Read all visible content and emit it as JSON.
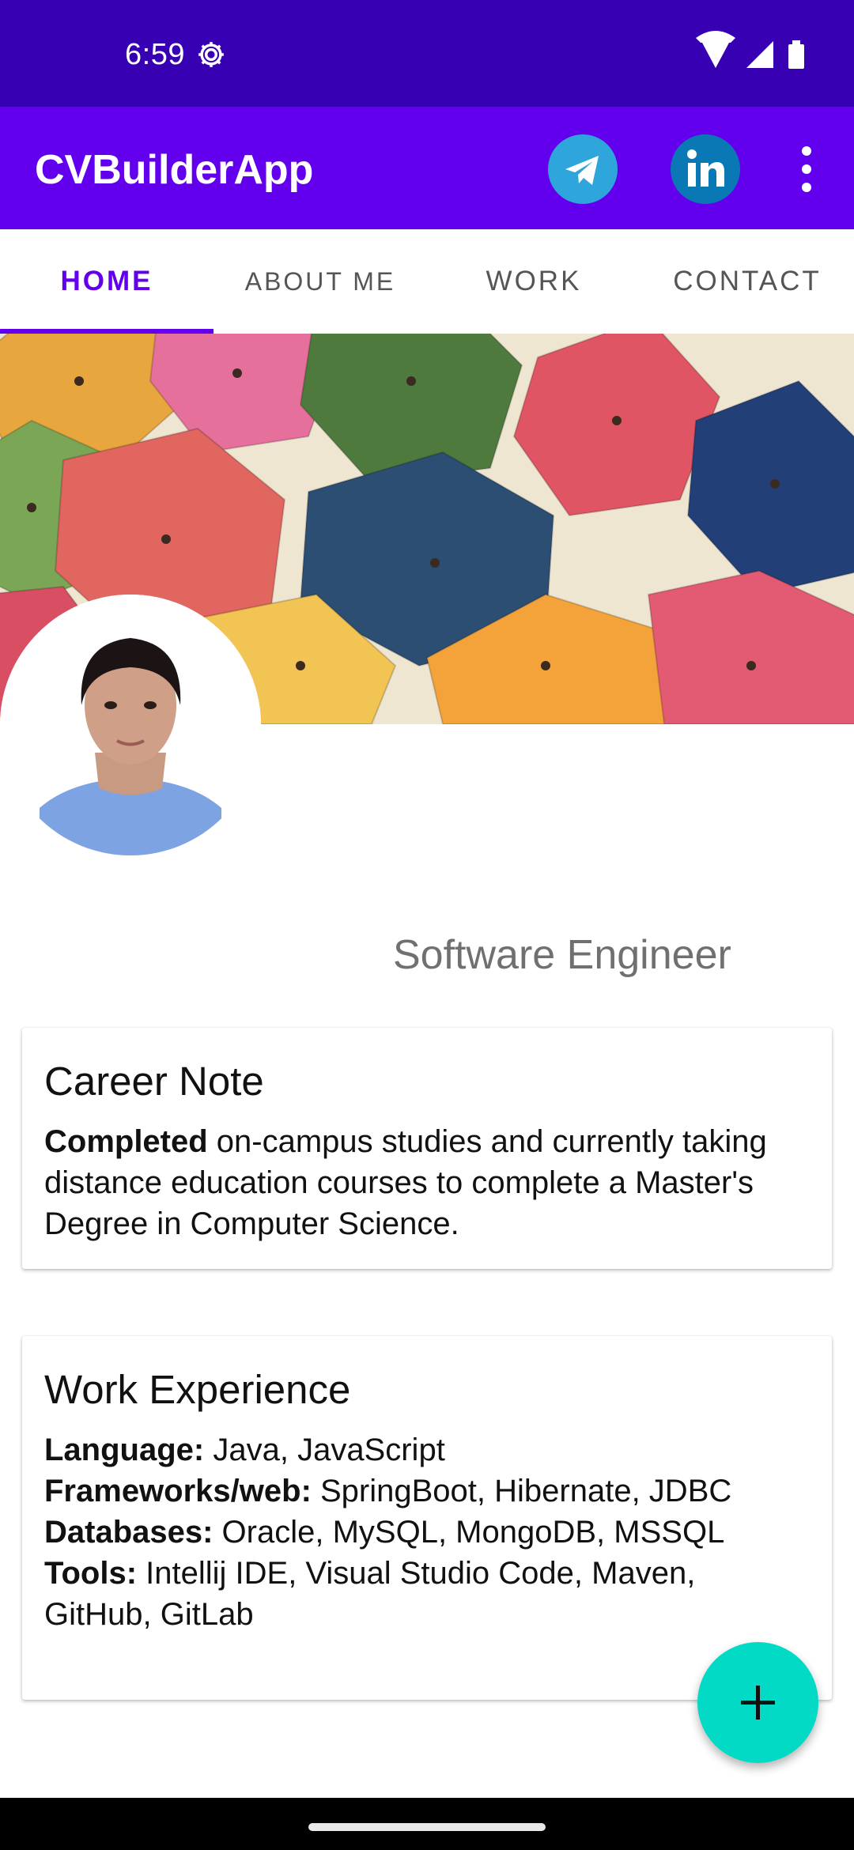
{
  "status": {
    "time": "6:59"
  },
  "app_bar": {
    "title": "CVBuilderApp"
  },
  "tabs": [
    {
      "label": "HOME",
      "active": true
    },
    {
      "label": "ABOUT ME",
      "active": false
    },
    {
      "label": "WORK",
      "active": false
    },
    {
      "label": "CONTACT",
      "active": false
    }
  ],
  "profile": {
    "subtitle": "Software Engineer"
  },
  "career_note": {
    "title": "Career Note",
    "bold_lead": "Completed",
    "text": " on-campus studies and currently taking distance education courses to complete a Master's Degree in Computer Science."
  },
  "work_experience": {
    "title": "Work Experience",
    "rows": [
      {
        "label": "Language:",
        "value": " Java, JavaScript"
      },
      {
        "label": "Frameworks/web:",
        "value": " SpringBoot, Hibernate, JDBC"
      },
      {
        "label": "Databases:",
        "value": " Oracle, MySQL, MongoDB, MSSQL"
      },
      {
        "label": "Tools:",
        "value": " Intellij IDE, Visual Studio Code, Maven, GitHub, GitLab"
      }
    ]
  },
  "colors": {
    "status_bar": "#3700b3",
    "app_bar": "#6200ee",
    "accent": "#6200ee",
    "fab": "#03dac5",
    "telegram": "#2ea6dc",
    "linkedin": "#0a78b5"
  },
  "icons": {
    "status": [
      "gear-icon",
      "wifi-icon",
      "signal-icon",
      "battery-icon"
    ],
    "app_bar": [
      "telegram-icon",
      "linkedin-icon",
      "overflow-menu-icon"
    ],
    "fab": "plus-icon"
  }
}
